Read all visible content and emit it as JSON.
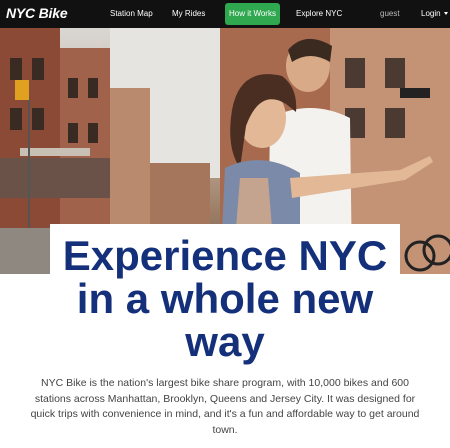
{
  "navbar": {
    "brand": "NYC Bike",
    "items": [
      {
        "label": "Station Map"
      },
      {
        "label": "My Rides"
      },
      {
        "label": "How it Works",
        "active": true
      },
      {
        "label": "Explore NYC"
      }
    ],
    "user": "guest",
    "login": "Login",
    "active_color": "#2fa84f",
    "background": "#111111"
  },
  "hero": {
    "image_subject": "couple-pointing-street-photo",
    "headline": "Experience NYC in a whole new way",
    "headline_color": "#14307a",
    "description": "NYC Bike is the nation's largest bike share program, with 10,000 bikes and 600 stations across Manhattan, Brooklyn, Queens and Jersey City. It was designed for quick trips with convenience in mind, and it's a fun and affordable way to get around town."
  }
}
